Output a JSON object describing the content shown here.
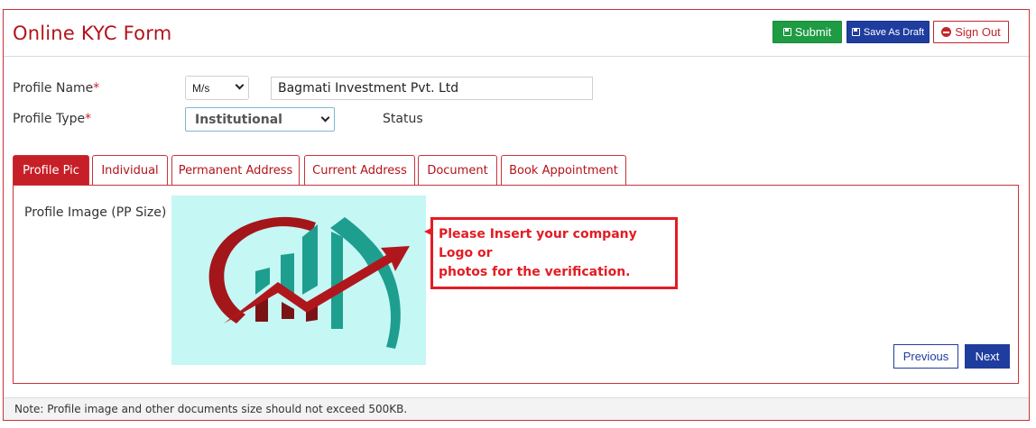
{
  "header": {
    "title": "Online KYC Form",
    "submit_label": "Submit",
    "draft_label": "Save As Draft",
    "signout_label": "Sign Out"
  },
  "form": {
    "profile_name_label": "Profile Name",
    "profile_type_label": "Profile Type",
    "required_mark": "*",
    "salutation_value": "M/s",
    "name_value": "Bagmati Investment Pvt. Ltd",
    "type_value": "Institutional",
    "status_label": "Status"
  },
  "tabs": [
    {
      "label": "Profile Pic",
      "active": true
    },
    {
      "label": "Individual",
      "active": false
    },
    {
      "label": "Permanent Address",
      "active": false
    },
    {
      "label": "Current Address",
      "active": false
    },
    {
      "label": "Document",
      "active": false
    },
    {
      "label": "Book Appointment",
      "active": false
    }
  ],
  "panel": {
    "image_label": "Profile Image (PP Size)",
    "notice_line1": "Please Insert your company Logo or",
    "notice_line2": "photos for the verification.",
    "previous_label": "Previous",
    "next_label": "Next"
  },
  "footer": {
    "note": "Note: Profile image and other documents size should not exceed 500KB."
  },
  "colors": {
    "accent_red": "#c71f27",
    "submit_green": "#1e9b43",
    "primary_blue": "#1f3d9e",
    "logo_bg": "#c5f7f5"
  }
}
